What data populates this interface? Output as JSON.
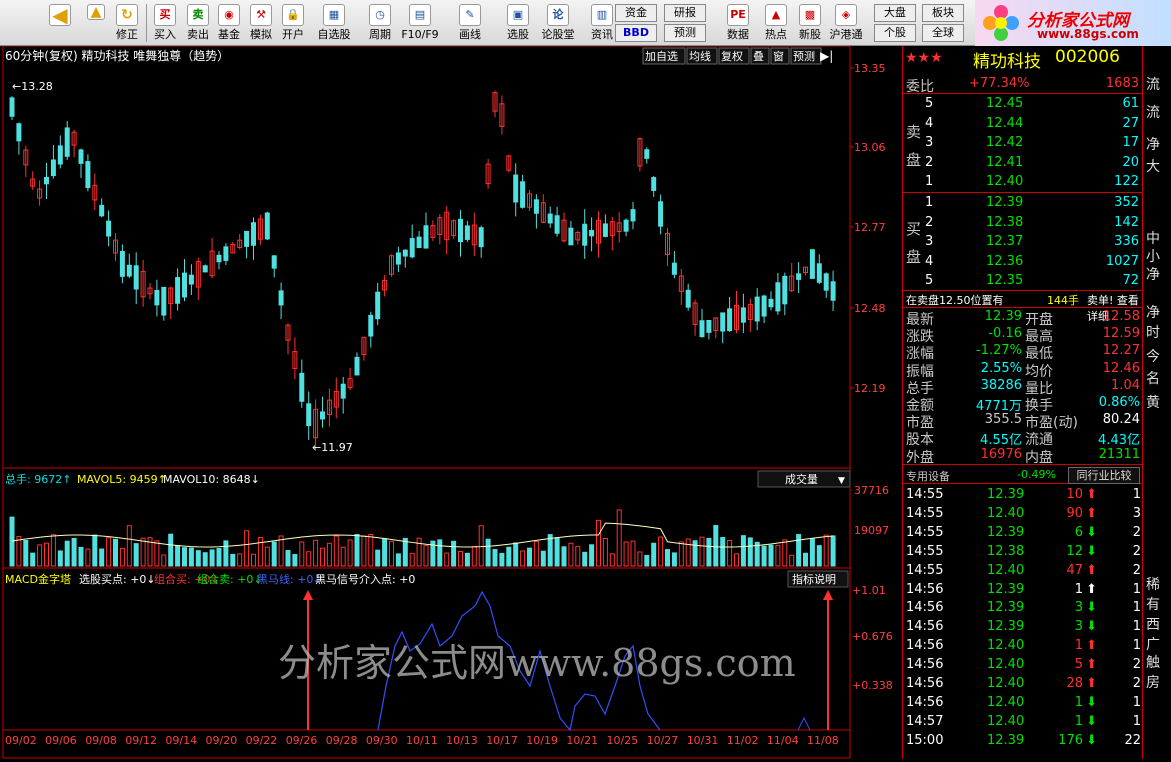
{
  "toolbar": {
    "buttons": [
      "买入",
      "卖出",
      "基金",
      "模拟",
      "开户",
      "自选股",
      "周期",
      "F10/F9",
      "画线",
      "选股",
      "论股堂",
      "资讯",
      "数据",
      "热点",
      "新股",
      "沪港通"
    ],
    "nav": [
      "修正"
    ],
    "fund": "资金",
    "bbd": "BBD",
    "research": "研报",
    "predict": "预测",
    "market": "大盘",
    "sector": "板块",
    "stock": "个股",
    "global": "全球"
  },
  "logo": {
    "title": "分析家公式网",
    "url": "www.88gs.com"
  },
  "chart": {
    "header": "60分钟(复权)  精功科技 唯舞独尊（趋势）",
    "header_btns": [
      "加自选",
      "均线",
      "复权",
      "叠",
      "窗",
      "预测"
    ],
    "price_ticks": [
      "13.35",
      "13.06",
      "12.77",
      "12.48",
      "12.19"
    ],
    "hi_label": "13.28",
    "lo_label": "11.97",
    "vol_info": [
      "总手: 9672",
      "MAVOL5: 9459",
      "MAVOL10: 8648"
    ],
    "vol_select": "成交量",
    "vol_ticks": [
      "37716",
      "19097"
    ],
    "macd_info": [
      "MACD金字塔",
      "选股买点: +0",
      "组合买: +0",
      "组合卖: +0",
      "黑马线: +0",
      "黑马信号介入点: +0"
    ],
    "indicator_btn": "指标说明",
    "macd_ticks": [
      "+1.01",
      "+0.676",
      "+0.338"
    ],
    "watermark": "分析家公式网www.88gs.com",
    "dates": [
      "09/02",
      "09/06",
      "09/08",
      "09/12",
      "09/14",
      "09/20",
      "09/22",
      "09/26",
      "09/28",
      "09/30",
      "10/11",
      "10/13",
      "10/17",
      "10/19",
      "10/21",
      "10/25",
      "10/27",
      "10/31",
      "11/02",
      "11/04",
      "11/08"
    ]
  },
  "quote": {
    "stars": "★★★",
    "name": "精功科技",
    "code": "002006",
    "wb_label": "委比",
    "wb": "+77.34%",
    "wb_v": "1683",
    "sell_label": "卖盘",
    "buy_label": "买盘",
    "sell": [
      [
        "5",
        "12.45",
        "61"
      ],
      [
        "4",
        "12.44",
        "27"
      ],
      [
        "3",
        "12.42",
        "17"
      ],
      [
        "2",
        "12.41",
        "20"
      ],
      [
        "1",
        "12.40",
        "122"
      ]
    ],
    "buy": [
      [
        "1",
        "12.39",
        "352"
      ],
      [
        "2",
        "12.38",
        "142"
      ],
      [
        "3",
        "12.37",
        "336"
      ],
      [
        "4",
        "12.36",
        "1027"
      ],
      [
        "5",
        "12.35",
        "72"
      ]
    ],
    "notice1": "在卖盘12.50位置有",
    "notice2": "144手",
    "notice3": "卖单! 查看详细",
    "stats": [
      [
        "最新",
        "12.39",
        "开盘",
        "12.58"
      ],
      [
        "涨跌",
        "-0.16",
        "最高",
        "12.59"
      ],
      [
        "涨幅",
        "-1.27%",
        "最低",
        "12.27"
      ],
      [
        "振幅",
        "2.55%",
        "均价",
        "12.46"
      ],
      [
        "总手",
        "38286",
        "量比",
        "1.04"
      ],
      [
        "金额",
        "4771万",
        "换手",
        "0.86%"
      ],
      [
        "市盈",
        "355.5",
        "市盈(动)",
        "80.24"
      ],
      [
        "股本",
        "4.55亿",
        "流通",
        "4.43亿"
      ],
      [
        "外盘",
        "16976",
        "内盘",
        "21311"
      ]
    ],
    "sector": "专用设备",
    "sector_chg": "-0.49%",
    "compare": "同行业比较",
    "ticks": [
      [
        "14:55",
        "12.39",
        "10",
        "1"
      ],
      [
        "14:55",
        "12.40",
        "90",
        "3"
      ],
      [
        "14:55",
        "12.39",
        "6",
        "2"
      ],
      [
        "14:55",
        "12.38",
        "12",
        "2"
      ],
      [
        "14:55",
        "12.40",
        "47",
        "2"
      ],
      [
        "14:56",
        "12.39",
        "1",
        "1"
      ],
      [
        "14:56",
        "12.39",
        "3",
        "1"
      ],
      [
        "14:56",
        "12.39",
        "3",
        "1"
      ],
      [
        "14:56",
        "12.40",
        "1",
        "1"
      ],
      [
        "14:56",
        "12.40",
        "5",
        "2"
      ],
      [
        "14:56",
        "12.40",
        "28",
        "2"
      ],
      [
        "14:56",
        "12.40",
        "1",
        "1"
      ],
      [
        "14:57",
        "12.40",
        "1",
        "1"
      ],
      [
        "15:00",
        "12.39",
        "176",
        "22"
      ]
    ]
  },
  "edge": [
    "流",
    "流",
    "净",
    "大",
    "中",
    "小",
    "净",
    "净",
    "时",
    "今",
    "名",
    "黄",
    "稀",
    "有",
    "西",
    "广",
    "触",
    "房"
  ]
}
